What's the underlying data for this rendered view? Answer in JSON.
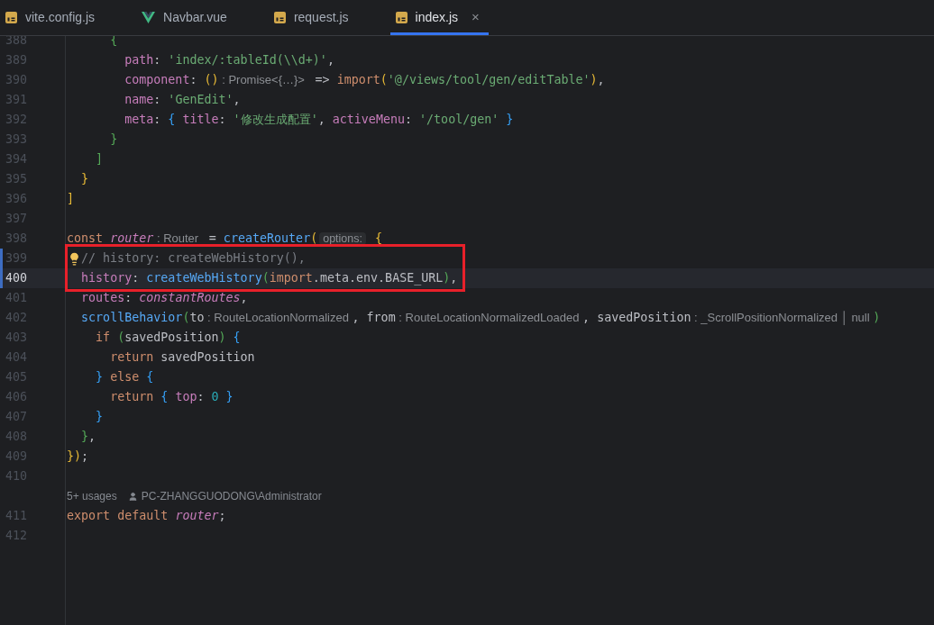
{
  "tabs": [
    {
      "label": "vite.config.js",
      "kind": "js",
      "selected": false
    },
    {
      "label": "Navbar.vue",
      "kind": "vue",
      "selected": false
    },
    {
      "label": "request.js",
      "kind": "js",
      "selected": false
    },
    {
      "label": "index.js",
      "kind": "js",
      "selected": true,
      "close": "×"
    }
  ],
  "lines": [
    {
      "kind": "code",
      "number": "388",
      "tokens": [
        {
          "kind": "brace2",
          "text": "      {"
        }
      ]
    },
    {
      "kind": "code",
      "number": "389",
      "tokens": [
        {
          "kind": "property",
          "text": "        path"
        },
        {
          "kind": "plain",
          "text": ": "
        },
        {
          "kind": "string",
          "text": "'index/:tableId(\\\\d+)'"
        },
        {
          "kind": "plain",
          "text": ","
        }
      ]
    },
    {
      "kind": "code",
      "number": "390",
      "tokens": [
        {
          "kind": "property",
          "text": "        component"
        },
        {
          "kind": "plain",
          "text": ": "
        },
        {
          "kind": "brace1",
          "text": "()"
        },
        {
          "kind": "hint",
          "text": " : Promise<{…}> "
        },
        {
          "kind": "plain",
          "text": " => "
        },
        {
          "kind": "keyword",
          "text": "import"
        },
        {
          "kind": "brace1",
          "text": "("
        },
        {
          "kind": "string",
          "text": "'@/views/tool/gen/editTable'"
        },
        {
          "kind": "brace1",
          "text": ")"
        },
        {
          "kind": "plain",
          "text": ","
        }
      ]
    },
    {
      "kind": "code",
      "number": "391",
      "tokens": [
        {
          "kind": "property",
          "text": "        name"
        },
        {
          "kind": "plain",
          "text": ": "
        },
        {
          "kind": "string",
          "text": "'GenEdit'"
        },
        {
          "kind": "plain",
          "text": ","
        }
      ]
    },
    {
      "kind": "code",
      "number": "392",
      "tokens": [
        {
          "kind": "property",
          "text": "        meta"
        },
        {
          "kind": "plain",
          "text": ": "
        },
        {
          "kind": "brace3",
          "text": "{ "
        },
        {
          "kind": "property",
          "text": "title"
        },
        {
          "kind": "plain",
          "text": ": "
        },
        {
          "kind": "string",
          "text": "'修改生成配置'"
        },
        {
          "kind": "plain",
          "text": ", "
        },
        {
          "kind": "property",
          "text": "activeMenu"
        },
        {
          "kind": "plain",
          "text": ": "
        },
        {
          "kind": "string",
          "text": "'/tool/gen'"
        },
        {
          "kind": "brace3",
          "text": " }"
        }
      ]
    },
    {
      "kind": "code",
      "number": "393",
      "tokens": [
        {
          "kind": "brace2",
          "text": "      }"
        }
      ]
    },
    {
      "kind": "code",
      "number": "394",
      "tokens": [
        {
          "kind": "brace2",
          "text": "    ]"
        }
      ]
    },
    {
      "kind": "code",
      "number": "395",
      "tokens": [
        {
          "kind": "brace1",
          "text": "  }"
        }
      ]
    },
    {
      "kind": "code",
      "number": "396",
      "tokens": [
        {
          "kind": "brace1",
          "text": "]"
        }
      ]
    },
    {
      "kind": "code",
      "number": "397"
    },
    {
      "kind": "code",
      "number": "398",
      "tokens": [
        {
          "kind": "keyword",
          "text": "const "
        },
        {
          "kind": "italic",
          "text": "router"
        },
        {
          "kind": "hint",
          "text": " : Router "
        },
        {
          "kind": "plain",
          "text": " = "
        },
        {
          "kind": "function",
          "text": "createRouter"
        },
        {
          "kind": "brace1",
          "text": "("
        },
        {
          "kind": "label",
          "text": "options:"
        },
        {
          "kind": "brace1",
          "text": " {"
        }
      ]
    },
    {
      "kind": "code",
      "number": "399",
      "changed": true,
      "boxed": true,
      "bulb": true,
      "tokens": [
        {
          "kind": "comment",
          "text": "// history: createWebHistory(),"
        }
      ]
    },
    {
      "kind": "code",
      "number": "400",
      "changed": true,
      "boxed": true,
      "current": true,
      "tokens": [
        {
          "kind": "property",
          "text": "  history"
        },
        {
          "kind": "plain",
          "text": ": "
        },
        {
          "kind": "function",
          "text": "createWebHistory"
        },
        {
          "kind": "brace2",
          "text": "("
        },
        {
          "kind": "keyword",
          "text": "import"
        },
        {
          "kind": "plain",
          "text": ".meta.env.BASE_URL"
        },
        {
          "kind": "brace2",
          "text": ")"
        },
        {
          "kind": "plain",
          "text": ","
        }
      ]
    },
    {
      "kind": "code",
      "number": "401",
      "tokens": [
        {
          "kind": "property",
          "text": "  routes"
        },
        {
          "kind": "plain",
          "text": ": "
        },
        {
          "kind": "italic",
          "text": "constantRoutes"
        },
        {
          "kind": "plain",
          "text": ","
        }
      ]
    },
    {
      "kind": "code",
      "number": "402",
      "tokens": [
        {
          "kind": "function",
          "text": "  scrollBehavior"
        },
        {
          "kind": "brace2",
          "text": "("
        },
        {
          "kind": "plain",
          "text": "to"
        },
        {
          "kind": "hint",
          "text": " : RouteLocationNormalized "
        },
        {
          "kind": "plain",
          "text": ", from"
        },
        {
          "kind": "hint",
          "text": " : RouteLocationNormalizedLoaded "
        },
        {
          "kind": "plain",
          "text": ", savedPosition"
        },
        {
          "kind": "hint",
          "text": " : _ScrollPositionNormalized │ null "
        },
        {
          "kind": "brace2",
          "text": ")"
        }
      ]
    },
    {
      "kind": "code",
      "number": "403",
      "tokens": [
        {
          "kind": "keyword",
          "text": "    if "
        },
        {
          "kind": "brace2",
          "text": "("
        },
        {
          "kind": "plain",
          "text": "savedPosition"
        },
        {
          "kind": "brace2",
          "text": ")"
        },
        {
          "kind": "brace3",
          "text": " {"
        }
      ]
    },
    {
      "kind": "code",
      "number": "404",
      "tokens": [
        {
          "kind": "keyword",
          "text": "      return"
        },
        {
          "kind": "plain",
          "text": " savedPosition"
        }
      ]
    },
    {
      "kind": "code",
      "number": "405",
      "tokens": [
        {
          "kind": "brace3",
          "text": "    }"
        },
        {
          "kind": "keyword",
          "text": " else "
        },
        {
          "kind": "brace3",
          "text": "{"
        }
      ]
    },
    {
      "kind": "code",
      "number": "406",
      "tokens": [
        {
          "kind": "keyword",
          "text": "      return"
        },
        {
          "kind": "brace3",
          "text": " { "
        },
        {
          "kind": "property",
          "text": "top"
        },
        {
          "kind": "plain",
          "text": ": "
        },
        {
          "kind": "number",
          "text": "0"
        },
        {
          "kind": "brace3",
          "text": " }"
        }
      ]
    },
    {
      "kind": "code",
      "number": "407",
      "tokens": [
        {
          "kind": "brace3",
          "text": "    }"
        }
      ]
    },
    {
      "kind": "code",
      "number": "408",
      "tokens": [
        {
          "kind": "brace2",
          "text": "  }"
        },
        {
          "kind": "plain",
          "text": ","
        }
      ]
    },
    {
      "kind": "code",
      "number": "409",
      "tokens": [
        {
          "kind": "brace1",
          "text": "})"
        },
        {
          "kind": "plain",
          "text": ";"
        }
      ]
    },
    {
      "kind": "code",
      "number": "410"
    },
    {
      "kind": "lens",
      "usages": "5+ usages",
      "author": "PC-ZHANGGUODONG\\Administrator"
    },
    {
      "kind": "code",
      "number": "411",
      "tokens": [
        {
          "kind": "keyword",
          "text": "export default "
        },
        {
          "kind": "italic",
          "text": "router"
        },
        {
          "kind": "plain",
          "text": ";"
        }
      ]
    },
    {
      "kind": "code",
      "number": "412"
    }
  ]
}
